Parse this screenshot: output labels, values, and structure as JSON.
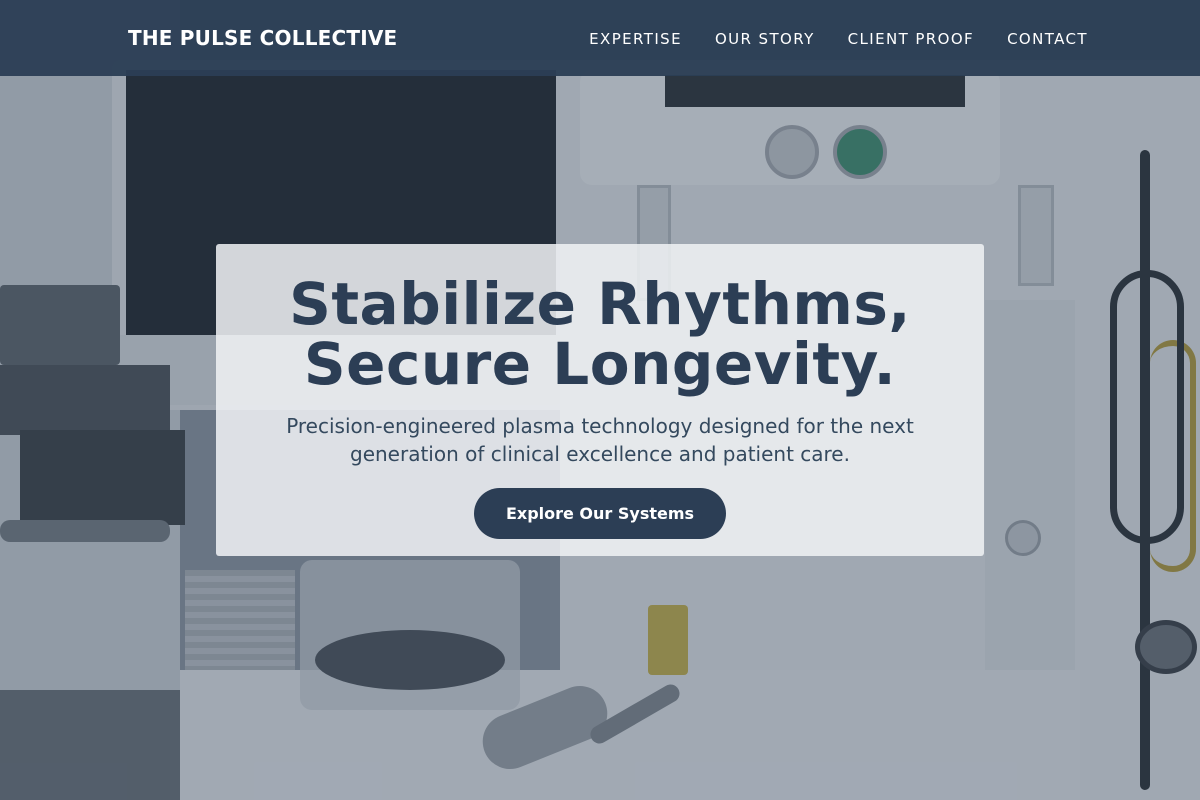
{
  "header": {
    "brand": "THE PULSE COLLECTIVE",
    "nav": [
      {
        "label": "EXPERTISE"
      },
      {
        "label": "OUR STORY"
      },
      {
        "label": "CLIENT PROOF"
      },
      {
        "label": "CONTACT"
      }
    ]
  },
  "hero": {
    "title_line1": "Stabilize Rhythms,",
    "title_line2": "Secure Longevity.",
    "subtitle": "Precision-engineered plasma technology designed for the next generation of clinical excellence and patient care.",
    "cta_label": "Explore Our Systems"
  },
  "colors": {
    "primary": "#2c3e55",
    "nav_text": "#ffffff",
    "card_bg": "#f0f2f5"
  }
}
